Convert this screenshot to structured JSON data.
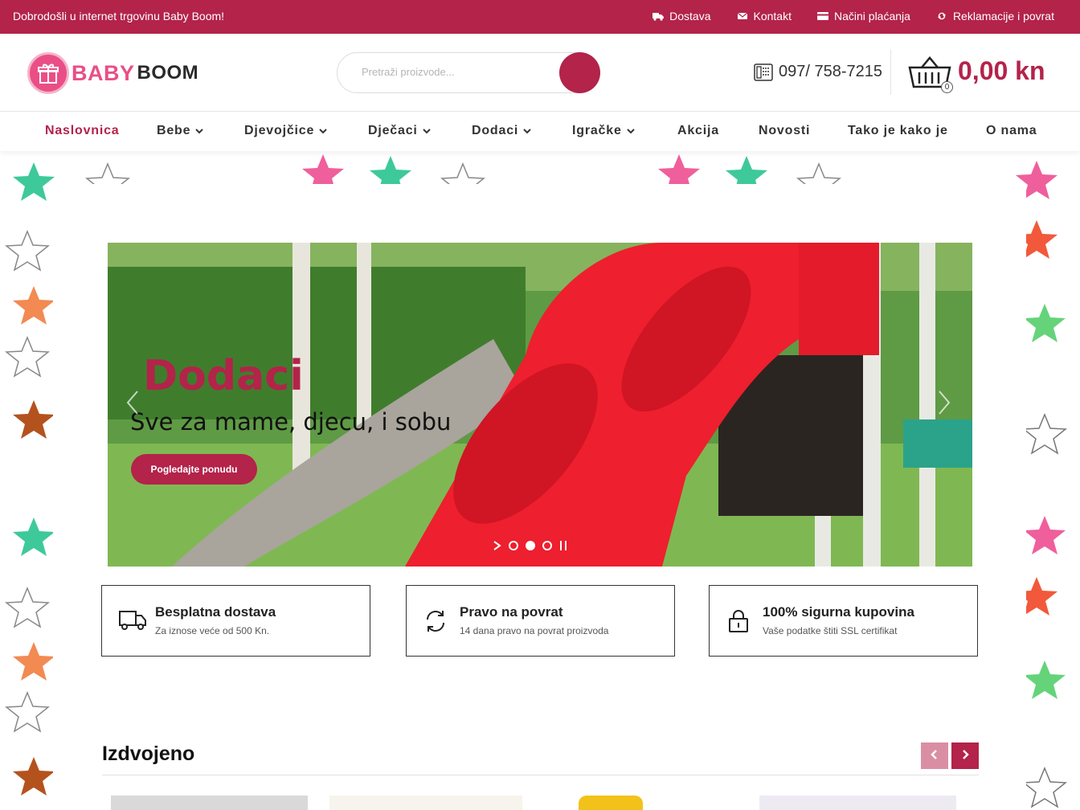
{
  "topbar": {
    "welcome": "Dobrodošli u internet trgovinu Baby Boom!",
    "links": [
      "Dostava",
      "Kontakt",
      "Načini plaćanja",
      "Reklamacije i povrat"
    ]
  },
  "header": {
    "logo_part1": "BABY",
    "logo_part2": "BOOM",
    "search_placeholder": "Pretraži proizvode...",
    "phone": "097/ 758-7215",
    "cart_count": "0",
    "cart_total": "0,00 kn"
  },
  "nav": {
    "items": [
      "Naslovnica",
      "Bebe",
      "Djevojčice",
      "Dječaci",
      "Dodaci",
      "Igračke",
      "Akcija",
      "Novosti",
      "Tako je kako je",
      "O nama"
    ]
  },
  "slider": {
    "title": "Dodaci",
    "subtitle": "Sve za mame, djecu, i sobu",
    "button": "Pogledajte ponudu",
    "active_slide": 2,
    "slide_count": 3
  },
  "features": [
    {
      "title": "Besplatna dostava",
      "subtitle": "Za iznose veće od 500 Kn.",
      "icon": "truck-icon"
    },
    {
      "title": "Pravo na povrat",
      "subtitle": "14 dana pravo na povrat proizvoda",
      "icon": "refresh-icon"
    },
    {
      "title": "100% sigurna kupovina",
      "subtitle": "Vaše podatke štiti SSL certifikat",
      "icon": "lock-icon"
    }
  ],
  "featured": {
    "title": "Izdvojeno"
  },
  "colors": {
    "brand": "#b3234a",
    "pink": "#e94f86",
    "green": "#3ec99a",
    "orange": "#f28a52",
    "brown": "#b4521e"
  }
}
